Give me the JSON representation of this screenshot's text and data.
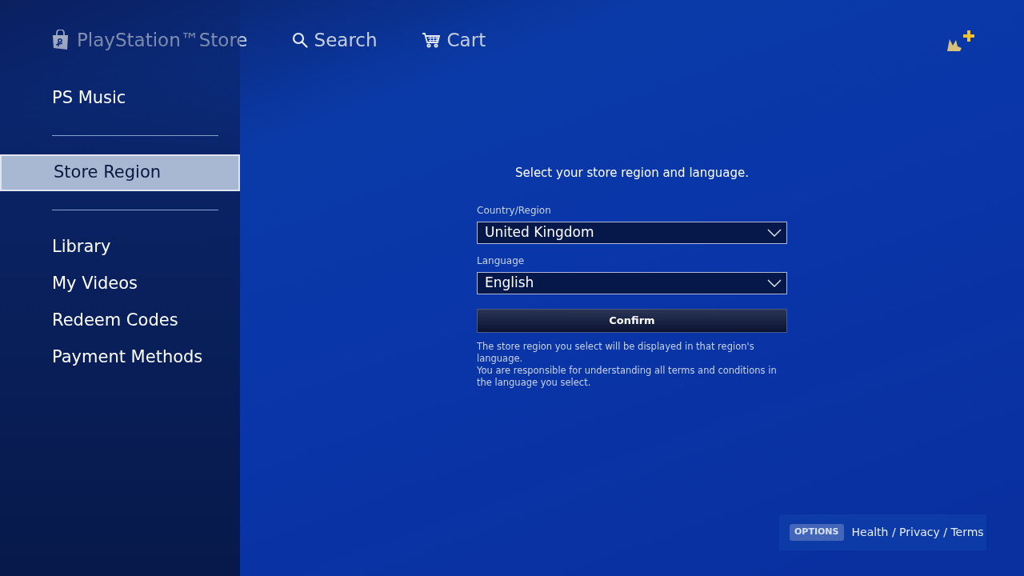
{
  "header": {
    "store_name": "PlayStation™Store",
    "nav": [
      {
        "kind": "search",
        "label": "Search"
      },
      {
        "kind": "cart",
        "label": "Cart"
      }
    ]
  },
  "sidebar": {
    "groups": [
      [
        {
          "label": "PS Music",
          "selected": false
        }
      ],
      [
        {
          "label": "Store Region",
          "selected": true
        }
      ],
      [
        {
          "label": "Library",
          "selected": false
        },
        {
          "label": "My Videos",
          "selected": false
        },
        {
          "label": "Redeem Codes",
          "selected": false
        },
        {
          "label": "Payment Methods",
          "selected": false
        }
      ]
    ]
  },
  "form": {
    "heading": "Select your store region and language.",
    "fields": [
      {
        "label": "Country/Region",
        "value": "United Kingdom"
      },
      {
        "label": "Language",
        "value": "English"
      }
    ],
    "button": "Confirm",
    "notes": [
      "The store region you select will be displayed in that region's language.",
      "You are responsible for understanding all terms and conditions in the language you select."
    ]
  },
  "footer": {
    "key": "OPTIONS",
    "links": "Health / Privacy / Terms"
  }
}
